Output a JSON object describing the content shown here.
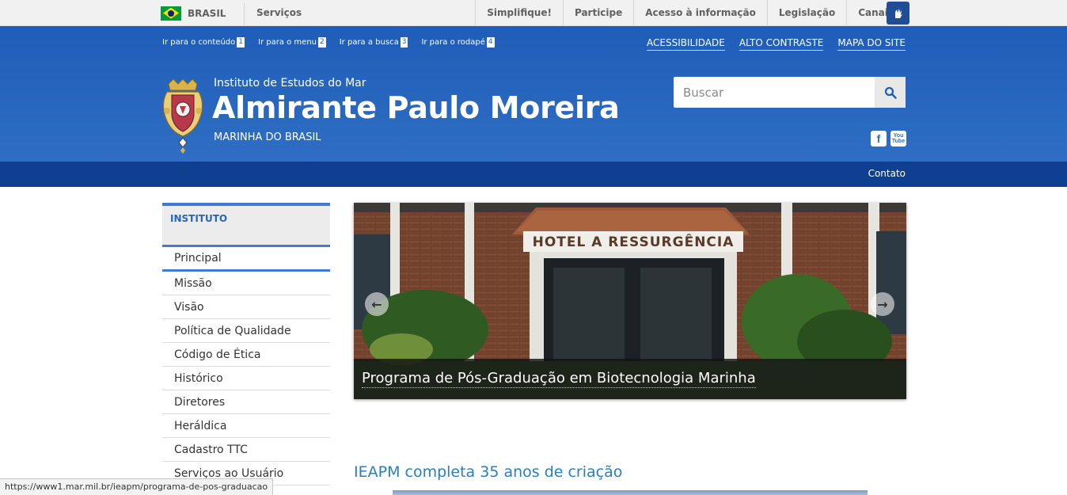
{
  "gov_bar": {
    "brasil": "BRASIL",
    "servicos": "Serviços",
    "links": [
      "Simplifique!",
      "Participe",
      "Acesso à informação",
      "Legislação",
      "Canais"
    ]
  },
  "header": {
    "skip_links": [
      {
        "label": "Ir para o conteúdo",
        "key": "1"
      },
      {
        "label": "Ir para o menu",
        "key": "2"
      },
      {
        "label": "Ir para a busca",
        "key": "3"
      },
      {
        "label": "Ir para o rodapé",
        "key": "4"
      }
    ],
    "accessibility_links": [
      "ACESSIBILIDADE",
      "ALTO CONTRASTE",
      "MAPA DO SITE"
    ],
    "subtitle": "Instituto de Estudos do Mar",
    "title": "Almirante Paulo Moreira",
    "org": "MARINHA DO BRASIL",
    "search_placeholder": "Buscar",
    "social": [
      "facebook-icon",
      "youtube-icon"
    ]
  },
  "nav": {
    "contato": "Contato"
  },
  "sidebar": {
    "heading": "INSTITUTO",
    "items": [
      "Principal",
      "Missão",
      "Visão",
      "Política de Qualidade",
      "Código de Ética",
      "Histórico",
      "Diretores",
      "Heráldica",
      "Cadastro TTC",
      "Serviços ao Usuário"
    ]
  },
  "carousel": {
    "sign_text": "HOTEL A RESSURGÊNCIA",
    "caption": "Programa de Pós-Graduação em Biotecnologia Marinha"
  },
  "news": {
    "title": "IEAPM completa 35 anos de criação"
  },
  "status_bar": {
    "url": "https://www1.mar.mil.br/ieapm/programa-de-pos-graduacao"
  },
  "colors": {
    "header_blue": "#2f6ec4",
    "nav_dark_blue": "#0e3f91",
    "accent": "#3f7ad3",
    "link_blue": "#2a7dbf"
  }
}
